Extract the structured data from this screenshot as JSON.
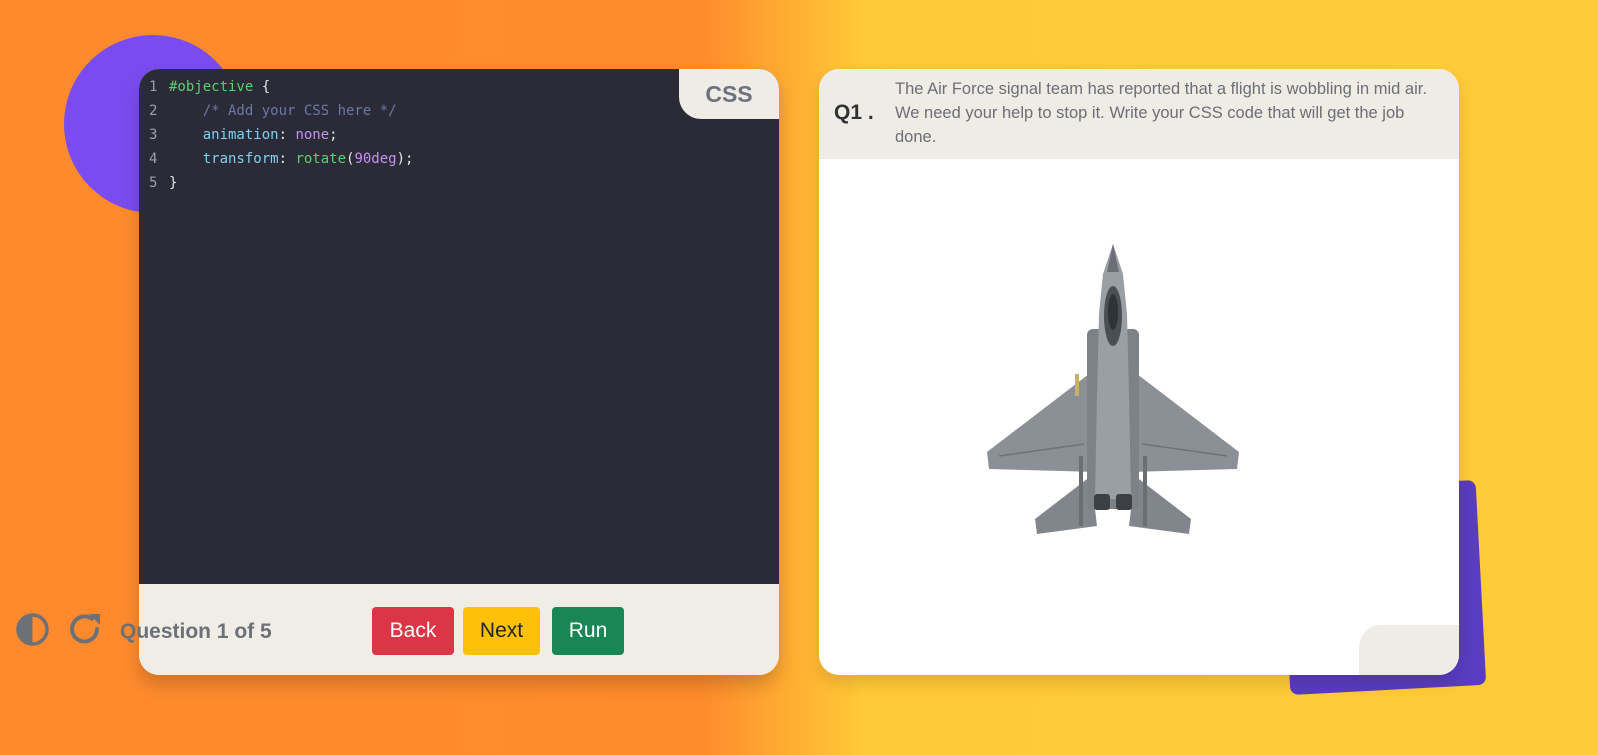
{
  "editor": {
    "tab_label": "CSS",
    "lines": [
      {
        "num": "1",
        "selector": "#objective",
        "brace": " {"
      },
      {
        "num": "2",
        "comment": "/* Add your CSS here */"
      },
      {
        "num": "3",
        "prop": "animation",
        "colon": ": ",
        "value": "none",
        "end": ";"
      },
      {
        "num": "4",
        "prop": "transform",
        "colon": ": ",
        "fn": "rotate",
        "open": "(",
        "value": "90deg",
        "close": ");"
      },
      {
        "num": "5",
        "brace": "}"
      }
    ]
  },
  "footer": {
    "contrast_icon": "contrast-icon",
    "redo_icon": "redo-icon",
    "status": "Question 1 of 5",
    "back_label": "Back",
    "next_label": "Next",
    "run_label": "Run"
  },
  "question": {
    "number": "Q1 .",
    "text": "The Air Force signal team has reported that a flight is wobbling in mid air. We need your help to stop it. Write your CSS code that will get the job done.",
    "image": "fighter-jet"
  },
  "colors": {
    "back": "#dc3545",
    "next": "#ffc107",
    "run": "#198754",
    "editor_bg": "#2a2b37"
  }
}
